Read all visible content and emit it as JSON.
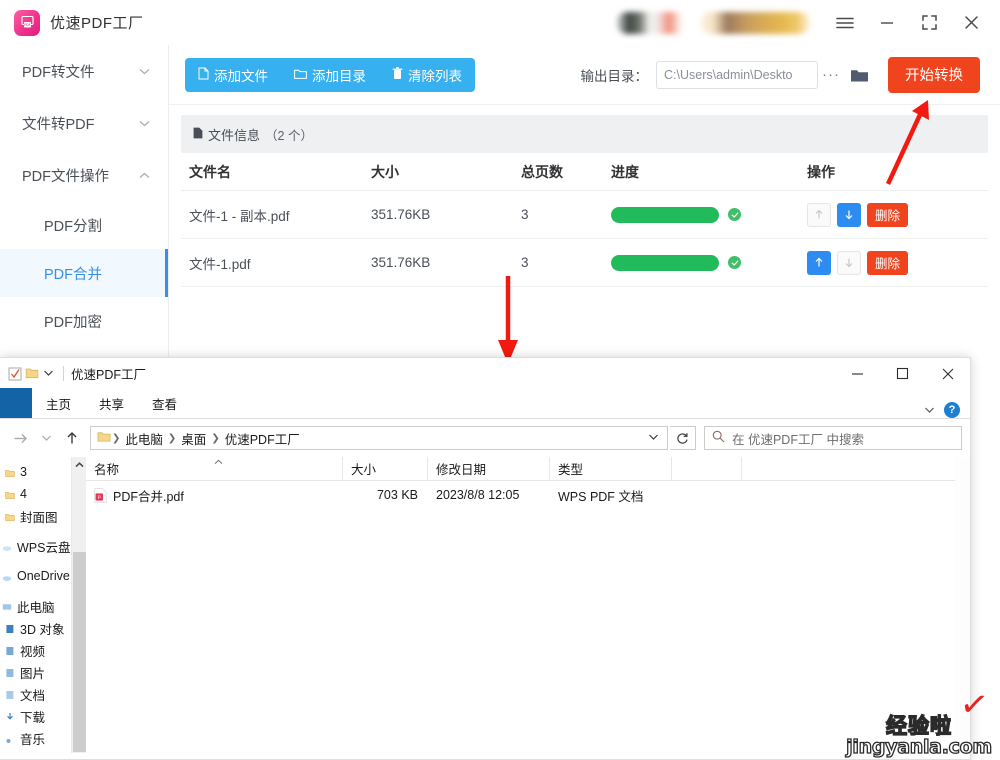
{
  "app": {
    "title": "优速PDF工厂",
    "logo_icon": "pdf-app-logo-icon",
    "titlebar": {
      "menu_icon": "hamburger-menu-icon",
      "minimize_icon": "minimize-icon",
      "maximize_icon": "maximize-icon",
      "close_icon": "close-icon"
    },
    "sidebar": {
      "groups": [
        {
          "label": "PDF转文件",
          "chevron": "chevron-down-icon",
          "expanded": false
        },
        {
          "label": "文件转PDF",
          "chevron": "chevron-down-icon",
          "expanded": false
        },
        {
          "label": "PDF文件操作",
          "chevron": "chevron-up-icon",
          "expanded": true
        }
      ],
      "sub_items": [
        {
          "label": "PDF分割",
          "active": false
        },
        {
          "label": "PDF合并",
          "active": true
        },
        {
          "label": "PDF加密",
          "active": false
        }
      ]
    },
    "toolbar": {
      "add_file": "添加文件",
      "add_file_icon": "file-icon",
      "add_dir": "添加目录",
      "add_dir_icon": "folder-icon",
      "clear_list": "清除列表",
      "clear_list_icon": "trash-icon",
      "output_label": "输出目录：",
      "output_path": "C:\\Users\\admin\\Deskto",
      "more_label": "···",
      "browse_icon": "folder-open-icon",
      "start_label": "开始转换"
    },
    "file_info": {
      "icon": "file-info-icon",
      "label": "文件信息",
      "count": "（2 个）"
    },
    "table": {
      "headers": [
        "文件名",
        "大小",
        "总页数",
        "进度",
        "操作"
      ],
      "rows": [
        {
          "name": "文件-1 - 副本.pdf",
          "size": "351.76KB",
          "pages": "3",
          "progress": 100,
          "status_icon": "check-circle-icon",
          "up_enabled": false,
          "down_enabled": true,
          "up_icon": "arrow-up-icon",
          "down_icon": "arrow-down-icon",
          "delete_label": "删除"
        },
        {
          "name": "文件-1.pdf",
          "size": "351.76KB",
          "pages": "3",
          "progress": 100,
          "status_icon": "check-circle-icon",
          "up_enabled": true,
          "down_enabled": false,
          "up_icon": "arrow-up-icon",
          "down_icon": "arrow-down-icon",
          "delete_label": "删除"
        }
      ]
    }
  },
  "annotations": {
    "arrow_to_start_button": "red-arrow-up-right",
    "arrow_to_explorer": "red-arrow-down",
    "color": "#f21a10"
  },
  "explorer": {
    "title": "优速PDF工厂",
    "quick_access_icons": [
      "save-icon",
      "folder-icon",
      "chevron-down-icon"
    ],
    "window_buttons": {
      "minimize_icon": "minimize-icon",
      "maximize_icon": "maximize-icon",
      "close_icon": "close-icon"
    },
    "ribbon": {
      "file_tab_icon": "file-menu-icon",
      "tabs": [
        "主页",
        "共享",
        "查看"
      ],
      "collapse_icon": "chevron-down-icon",
      "help_icon": "help-icon"
    },
    "address": {
      "back_icon": "arrow-left-icon",
      "forward_icon": "arrow-right-icon",
      "recent_icon": "chevron-down-icon",
      "up_icon": "arrow-up-icon",
      "folder_icon": "folder-icon",
      "breadcrumbs": [
        "此电脑",
        "桌面",
        "优速PDF工厂"
      ],
      "dropdown_icon": "chevron-down-icon",
      "refresh_icon": "refresh-icon",
      "search_icon": "search-icon",
      "search_placeholder": "在 优速PDF工厂 中搜索"
    },
    "nav_pane": {
      "items": [
        {
          "label": "3",
          "icon": "folder-icon",
          "indent": true,
          "gap": false
        },
        {
          "label": "4",
          "icon": "folder-icon",
          "indent": true,
          "gap": false
        },
        {
          "label": "封面图",
          "icon": "folder-icon",
          "indent": true,
          "gap": false
        },
        {
          "label": "WPS云盘",
          "icon": "cloud-icon",
          "indent": false,
          "gap": true
        },
        {
          "label": "OneDrive",
          "icon": "onedrive-icon",
          "indent": false,
          "gap": true
        },
        {
          "label": "此电脑",
          "icon": "computer-icon",
          "indent": false,
          "gap": true
        },
        {
          "label": "3D 对象",
          "icon": "3d-objects-icon",
          "indent": true,
          "gap": false
        },
        {
          "label": "视频",
          "icon": "videos-icon",
          "indent": true,
          "gap": false
        },
        {
          "label": "图片",
          "icon": "pictures-icon",
          "indent": true,
          "gap": false
        },
        {
          "label": "文档",
          "icon": "documents-icon",
          "indent": true,
          "gap": false
        },
        {
          "label": "下载",
          "icon": "downloads-icon",
          "indent": true,
          "gap": false
        },
        {
          "label": "音乐",
          "icon": "music-icon",
          "indent": true,
          "gap": false
        }
      ],
      "scroll_up_icon": "chevron-up-icon"
    },
    "file_list": {
      "columns": [
        "名称",
        "大小",
        "修改日期",
        "类型"
      ],
      "sort_column": "名称",
      "sort_icon": "sort-ascending-icon",
      "rows": [
        {
          "name": "PDF合并.pdf",
          "icon": "pdf-file-icon",
          "size": "703 KB",
          "modified": "2023/8/8 12:05",
          "type": "WPS PDF 文档"
        }
      ]
    }
  },
  "watermark": {
    "cn": "经验啦",
    "en": "jingyanla.com",
    "check_icon": "checkmark-icon"
  }
}
